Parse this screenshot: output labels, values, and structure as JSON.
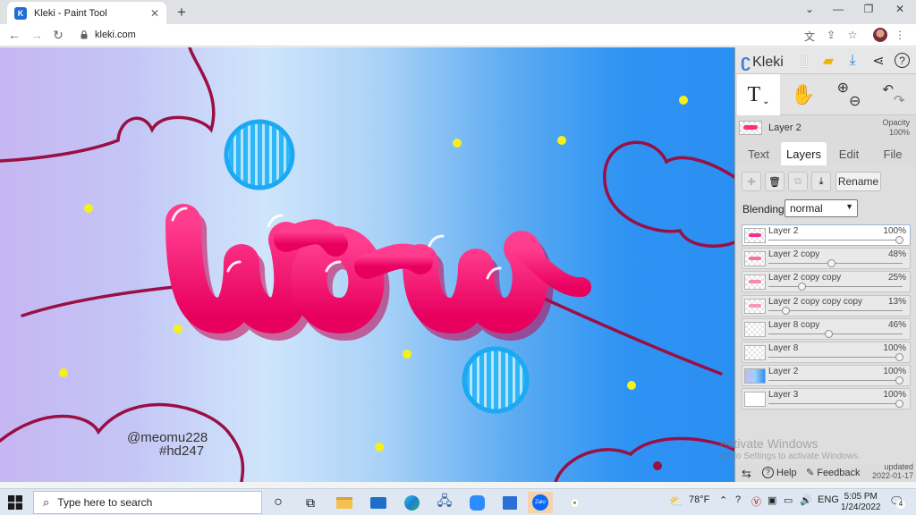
{
  "browser": {
    "tab_title": "Kleki - Paint Tool",
    "tab_favicon": "K",
    "url": "kleki.com"
  },
  "canvas": {
    "credit_line1": "@meomu228",
    "credit_line2": "#hd247",
    "artwork_word": "wow"
  },
  "kleki": {
    "logo": "Kleki",
    "layer_header": {
      "name": "Layer 2",
      "opacity_label": "Opacity",
      "opacity_value": "100%"
    },
    "tabs": [
      {
        "label": "Text"
      },
      {
        "label": "Layers"
      },
      {
        "label": "Edit"
      },
      {
        "label": "File"
      }
    ],
    "active_tab": "Layers",
    "rename_label": "Rename",
    "blending_label": "Blending",
    "blending_value": "normal",
    "layers": [
      {
        "name": "Layer 2",
        "opacity": "100%",
        "opacity_fraction": 1.0
      },
      {
        "name": "Layer 2 copy",
        "opacity": "48%",
        "opacity_fraction": 0.48
      },
      {
        "name": "Layer 2 copy copy",
        "opacity": "25%",
        "opacity_fraction": 0.25
      },
      {
        "name": "Layer 2 copy copy copy",
        "opacity": "13%",
        "opacity_fraction": 0.13
      },
      {
        "name": "Layer 8 copy",
        "opacity": "46%",
        "opacity_fraction": 0.46
      },
      {
        "name": "Layer 8",
        "opacity": "100%",
        "opacity_fraction": 1.0
      },
      {
        "name": "Layer 2",
        "opacity": "100%",
        "opacity_fraction": 1.0
      },
      {
        "name": "Layer 3",
        "opacity": "100%",
        "opacity_fraction": 1.0
      }
    ],
    "footer": {
      "help": "Help",
      "feedback": "Feedback",
      "updated_label": "updated",
      "updated_date": "2022-01-17"
    }
  },
  "watermark": {
    "line1": "Activate Windows",
    "line2": "Go to Settings to activate Windows."
  },
  "taskbar": {
    "search_placeholder": "Type here to search",
    "weather": "78°F",
    "language": "ENG",
    "time": "5:05 PM",
    "date": "1/24/2022",
    "notification_count": "4"
  },
  "colors": {
    "accent_pink": "#ff1f7a",
    "line_maroon": "#9a0f44",
    "dot_yellow": "#f4f01a",
    "circle_blue": "#1aa9f2"
  }
}
